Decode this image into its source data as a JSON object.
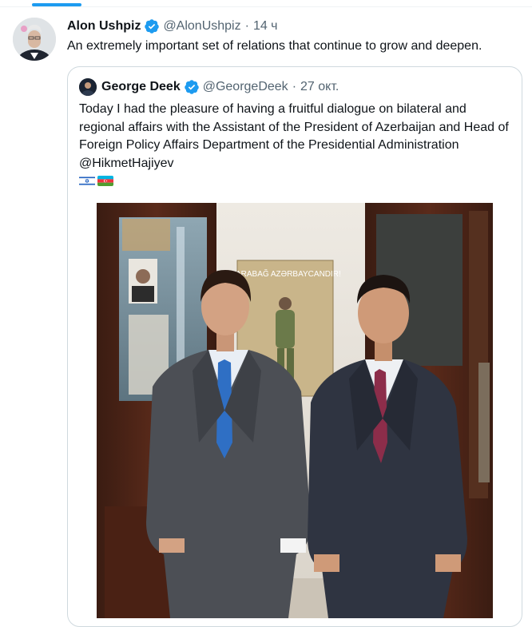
{
  "tab_indicator_color": "#1d9bf0",
  "tweet": {
    "author_name": "Alon Ushpiz",
    "author_handle": "@AlonUshpiz",
    "separator": "·",
    "time": "14 ч",
    "text": "An extremely important set of relations that continue to grow and deepen.",
    "avatar_icon": "user-avatar"
  },
  "quoted_tweet": {
    "author_name": "George Deek",
    "author_handle": "@GeorgeDeek",
    "separator": "·",
    "date": "27 окт.",
    "text": "Today I had the pleasure of having a fruitful dialogue on bilateral and regional affairs with the Assistant of the President of Azerbaijan and Head of Foreign Policy Affairs Department of the Presidential Administration @HikmetHajiyev",
    "flags": [
      "israel-flag-icon",
      "azerbaijan-flag-icon"
    ],
    "photo": {
      "calendar_text": "QARABAĞ AZƏRBAYCANDIR!"
    }
  },
  "colors": {
    "verified": "#1d9bf0",
    "secondary_text": "#536471",
    "border": "#cfd9de"
  }
}
